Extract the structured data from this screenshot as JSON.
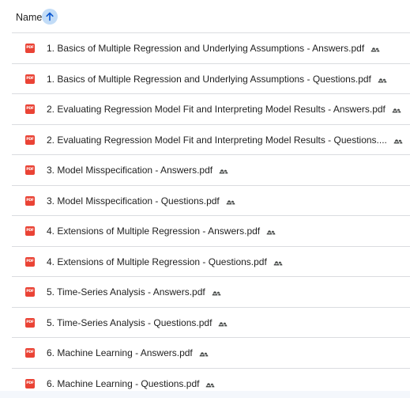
{
  "header": {
    "name_label": "Name",
    "sort_icon": "arrow-up-icon",
    "accent_color": "#c2dcf7"
  },
  "files": [
    {
      "name": "1. Basics of Multiple Regression and Underlying Assumptions - Answers.pdf",
      "icon": "pdf-icon",
      "shared": true
    },
    {
      "name": "1. Basics of Multiple Regression and Underlying Assumptions - Questions.pdf",
      "icon": "pdf-icon",
      "shared": true
    },
    {
      "name": "2. Evaluating Regression Model Fit and Interpreting Model Results - Answers.pdf",
      "icon": "pdf-icon",
      "shared": true
    },
    {
      "name": "2. Evaluating Regression Model Fit and Interpreting Model Results - Questions....",
      "icon": "pdf-icon",
      "shared": true
    },
    {
      "name": "3. Model Misspecification - Answers.pdf",
      "icon": "pdf-icon",
      "shared": true
    },
    {
      "name": "3. Model Misspecification - Questions.pdf",
      "icon": "pdf-icon",
      "shared": true
    },
    {
      "name": "4. Extensions of Multiple Regression - Answers.pdf",
      "icon": "pdf-icon",
      "shared": true
    },
    {
      "name": "4. Extensions of Multiple Regression - Questions.pdf",
      "icon": "pdf-icon",
      "shared": true
    },
    {
      "name": "5. Time-Series Analysis - Answers.pdf",
      "icon": "pdf-icon",
      "shared": true
    },
    {
      "name": "5. Time-Series Analysis - Questions.pdf",
      "icon": "pdf-icon",
      "shared": true
    },
    {
      "name": "6. Machine Learning - Answers.pdf",
      "icon": "pdf-icon",
      "shared": true
    },
    {
      "name": "6. Machine Learning - Questions.pdf",
      "icon": "pdf-icon",
      "shared": true
    }
  ],
  "pdf_badge_text": "PDF",
  "pdf_color": "#ea4335"
}
